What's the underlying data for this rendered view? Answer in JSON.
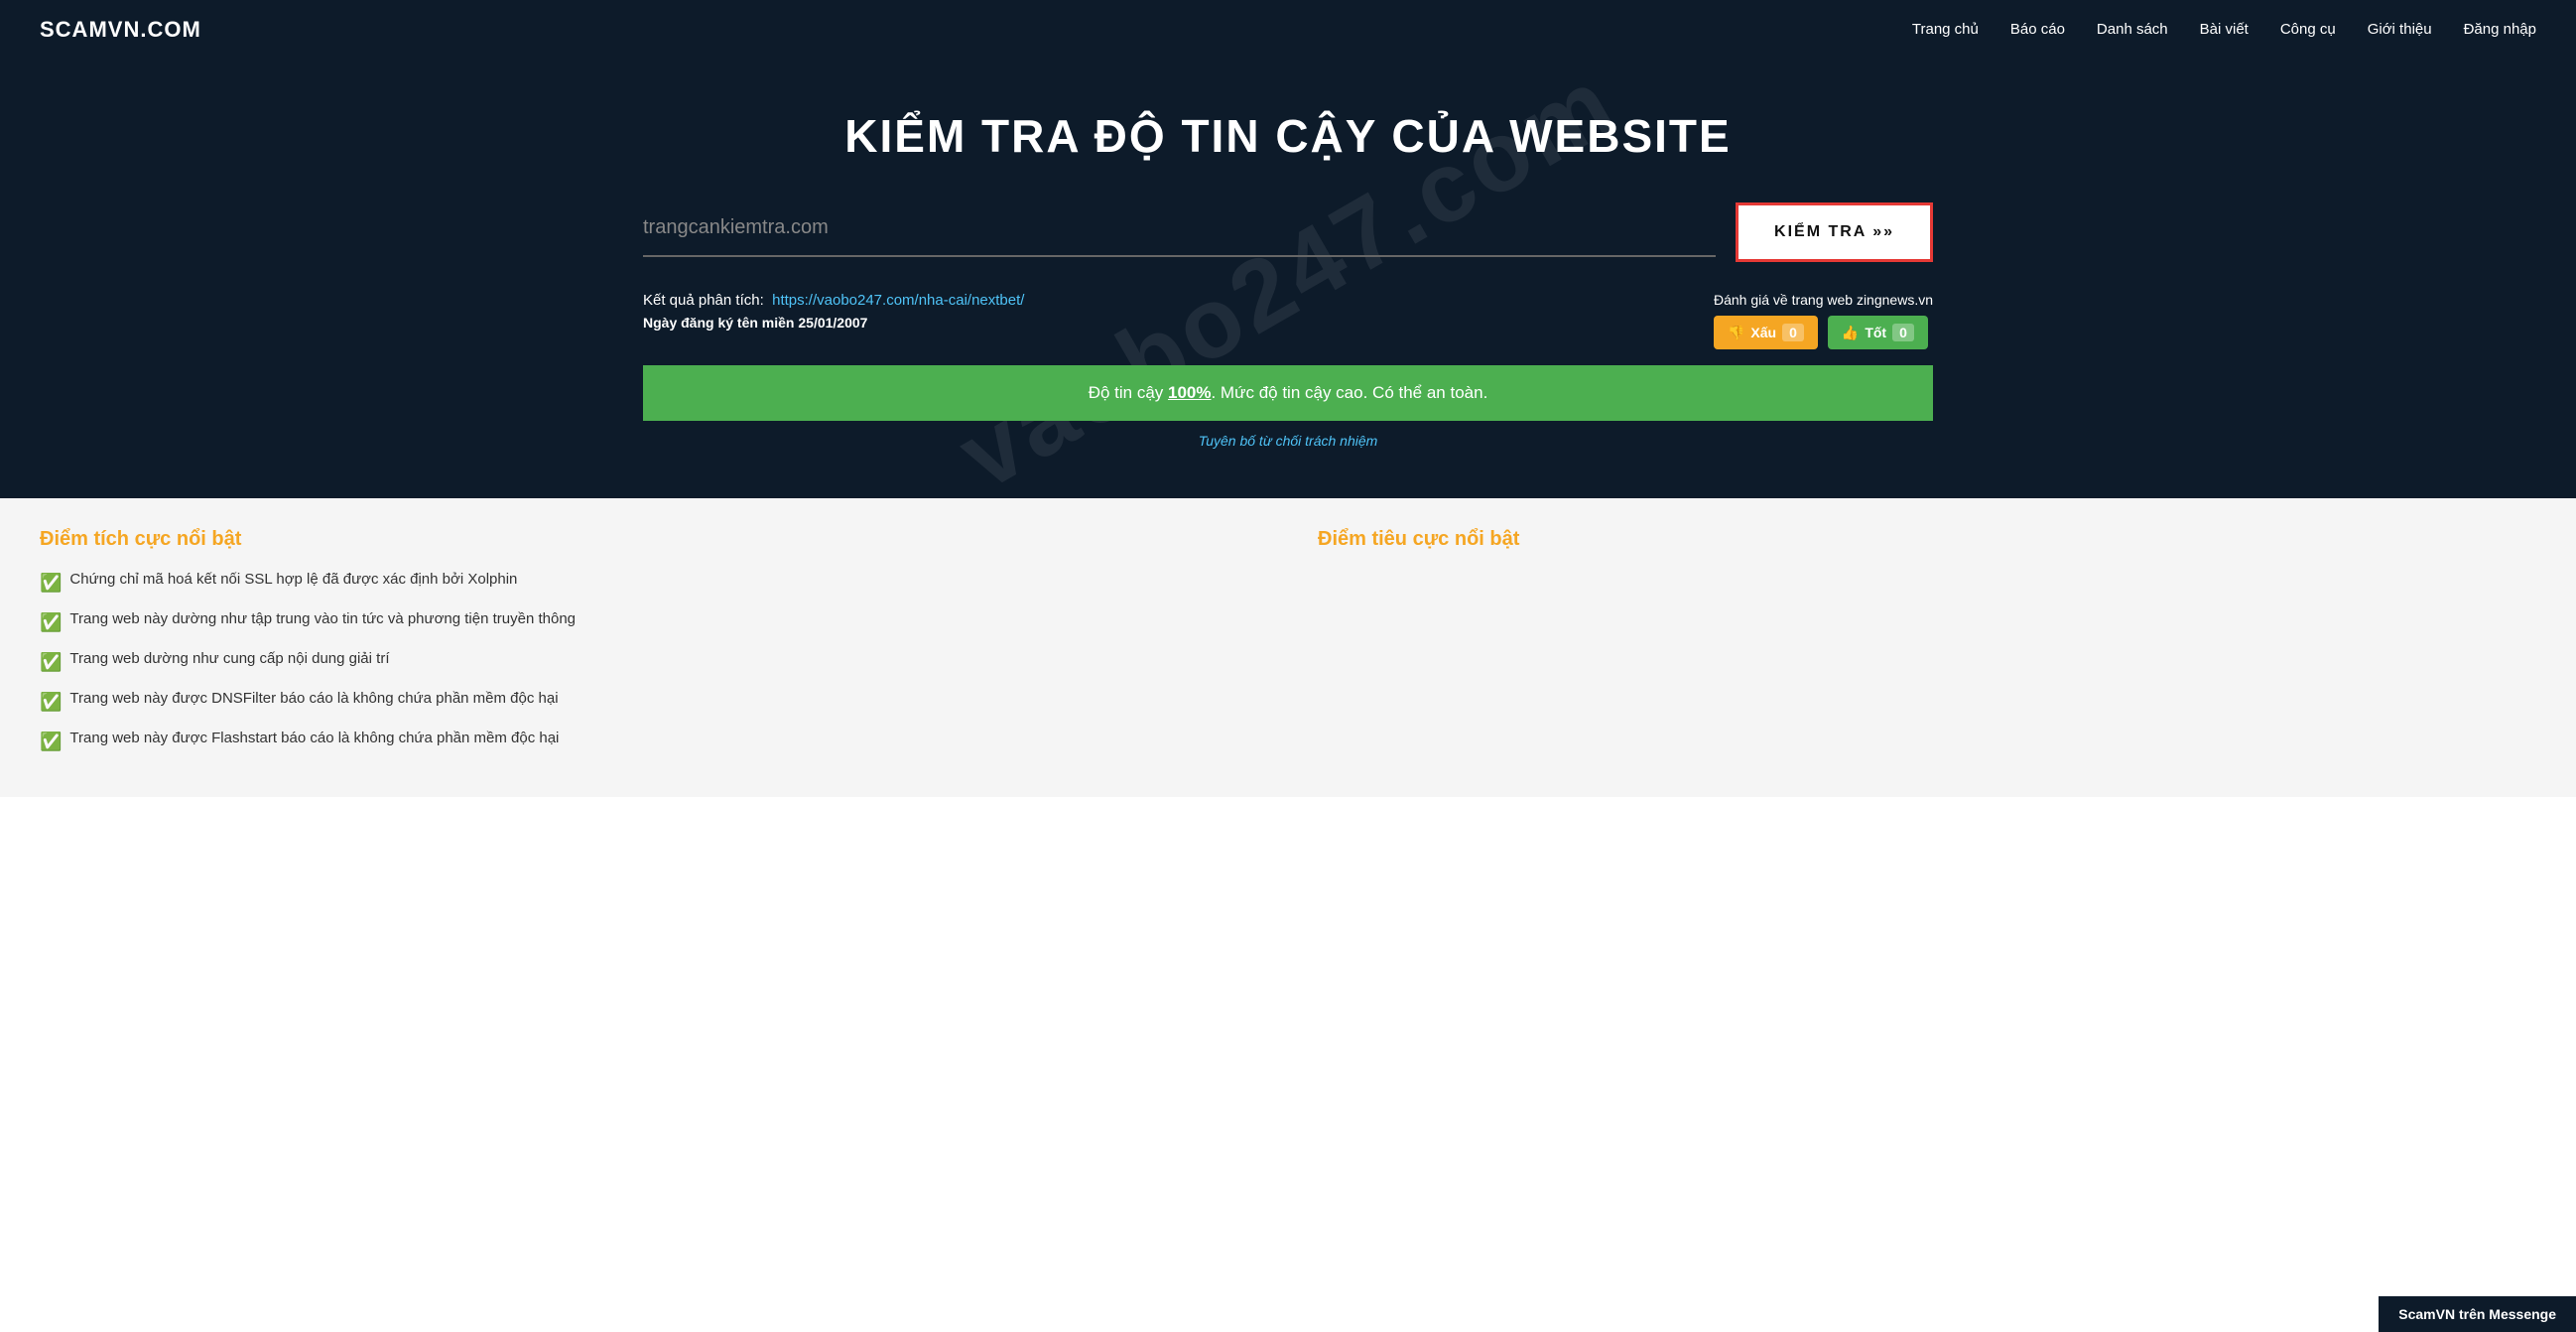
{
  "brand": "SCAMVN.COM",
  "nav": {
    "items": [
      {
        "label": "Trang chủ",
        "href": "#"
      },
      {
        "label": "Báo cáo",
        "href": "#"
      },
      {
        "label": "Danh sách",
        "href": "#"
      },
      {
        "label": "Bài viết",
        "href": "#"
      },
      {
        "label": "Công cụ",
        "href": "#"
      },
      {
        "label": "Giới thiệu",
        "href": "#"
      },
      {
        "label": "Đăng nhập",
        "href": "#"
      }
    ]
  },
  "hero": {
    "title": "KIỂM TRA ĐỘ TIN CẬY CỦA WEBSITE",
    "watermark": "vaobo247.com",
    "search_placeholder": "trangcankiemtra.com",
    "search_btn_label": "KIỂM TRA »»"
  },
  "result": {
    "label": "Kết quả phân tích:",
    "url": "https://vaobo247.com/nha-cai/nextbet/",
    "domain_reg_label": "Ngày đăng ký tên miền 25/01/2007",
    "rating_label": "Đánh giá về trang web zingnews.vn",
    "vote_bad_label": "Xấu",
    "vote_bad_count": "0",
    "vote_bad_icon": "👎",
    "vote_good_label": "Tốt",
    "vote_good_count": "0",
    "vote_good_icon": "👍"
  },
  "trust_bar": {
    "text_before": "Độ tin cậy ",
    "percent": "100%",
    "text_after": ". Mức độ tin cậy cao. Có thể an toàn."
  },
  "disclaimer": {
    "label": "Tuyên bố từ chối trách nhiệm"
  },
  "positive": {
    "title": "Điểm tích cực nổi bật",
    "items": [
      "Chứng chỉ mã hoá kết nối SSL hợp lệ đã được xác định bởi Xolphin",
      "Trang web này dường như tập trung vào tin tức và phương tiện truyền thông",
      "Trang web dường như cung cấp nội dung giải trí",
      "Trang web này được DNSFilter báo cáo là không chứa phần mềm độc hại",
      "Trang web này được Flashstart báo cáo là không chứa phần mềm độc hại"
    ]
  },
  "negative": {
    "title": "Điểm tiêu cực nổi bật",
    "items": []
  },
  "messenger": {
    "label": "ScamVN trên Messenge"
  }
}
